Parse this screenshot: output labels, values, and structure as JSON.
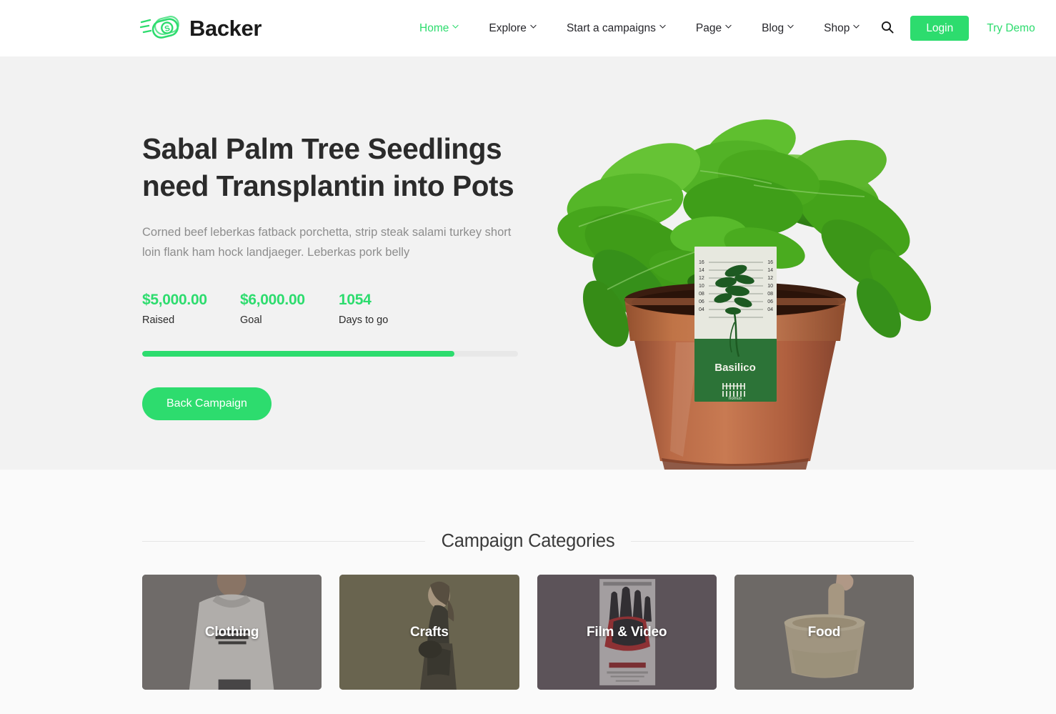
{
  "header": {
    "brand": {
      "name": "Backer",
      "logo_icon": "flying-money-icon",
      "logo_color": "#2ddc6e"
    },
    "nav": [
      {
        "label": "Home",
        "has_dropdown": true,
        "active": true
      },
      {
        "label": "Explore",
        "has_dropdown": true,
        "active": false
      },
      {
        "label": "Start a campaigns",
        "has_dropdown": true,
        "active": false
      },
      {
        "label": "Page",
        "has_dropdown": true,
        "active": false
      },
      {
        "label": "Blog",
        "has_dropdown": true,
        "active": false
      },
      {
        "label": "Shop",
        "has_dropdown": true,
        "active": false
      }
    ],
    "search_icon": "search-icon",
    "login_label": "Login",
    "try_demo_label": "Try Demo",
    "accent_color": "#2ddc6e"
  },
  "hero": {
    "title": "Sabal Palm Tree Seedlings need Transplantin into Pots",
    "description": "Corned beef leberkas fatback porchetta, strip steak salami turkey short loin flank ham hock landjaeger. Leberkas pork belly",
    "stats": [
      {
        "value": "$5,000.00",
        "label": "Raised"
      },
      {
        "value": "$6,000.00",
        "label": "Goal"
      },
      {
        "value": "1054",
        "label": "Days to go"
      }
    ],
    "progress_percent": 83,
    "cta_label": "Back Campaign",
    "background_color": "#f2f2f2",
    "image": {
      "alt": "Basil plant in terracotta pot",
      "label_title": "Basilico",
      "label_brand": "homus",
      "ruler_marks": [
        "16",
        "14",
        "12",
        "10",
        "08",
        "06",
        "04"
      ]
    }
  },
  "categories": {
    "title": "Campaign Categories",
    "background_color": "#fafafa",
    "items": [
      {
        "label": "Clothing",
        "tint": "#6f6c69",
        "art": "hoodie"
      },
      {
        "label": "Crafts",
        "tint": "#6a6450",
        "art": "model"
      },
      {
        "label": "Film & Video",
        "tint": "#5c5459",
        "art": "poster"
      },
      {
        "label": "Food",
        "tint": "#6d6a67",
        "art": "mortar"
      }
    ]
  }
}
